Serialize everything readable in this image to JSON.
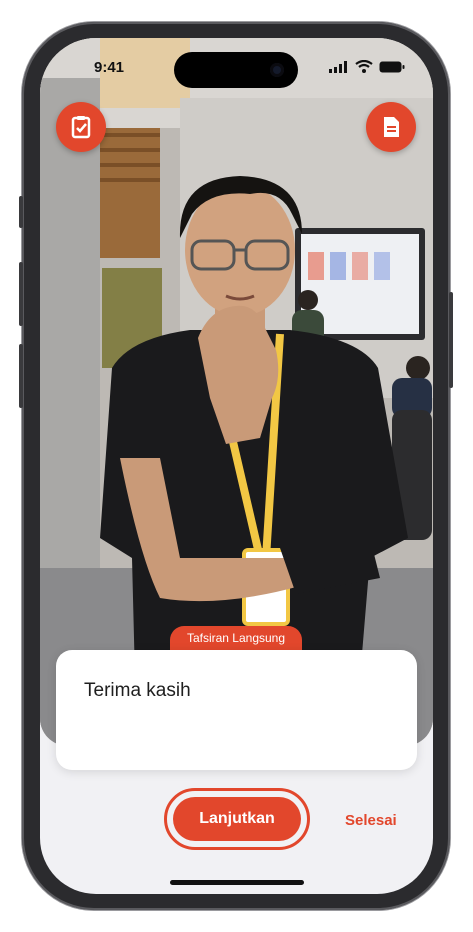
{
  "status_bar": {
    "time": "9:41"
  },
  "icons": {
    "checklist": "checklist-icon",
    "document": "document-icon",
    "signal": "signal-icon",
    "wifi": "wifi-icon",
    "battery": "battery-icon"
  },
  "live_tag": "Tafsiran Langsung",
  "transcript": "Terima kasih",
  "actions": {
    "continue_label": "Lanjutkan",
    "finish_label": "Selesai"
  },
  "colors": {
    "accent": "#e2472c",
    "surface": "#f1f1f4"
  }
}
